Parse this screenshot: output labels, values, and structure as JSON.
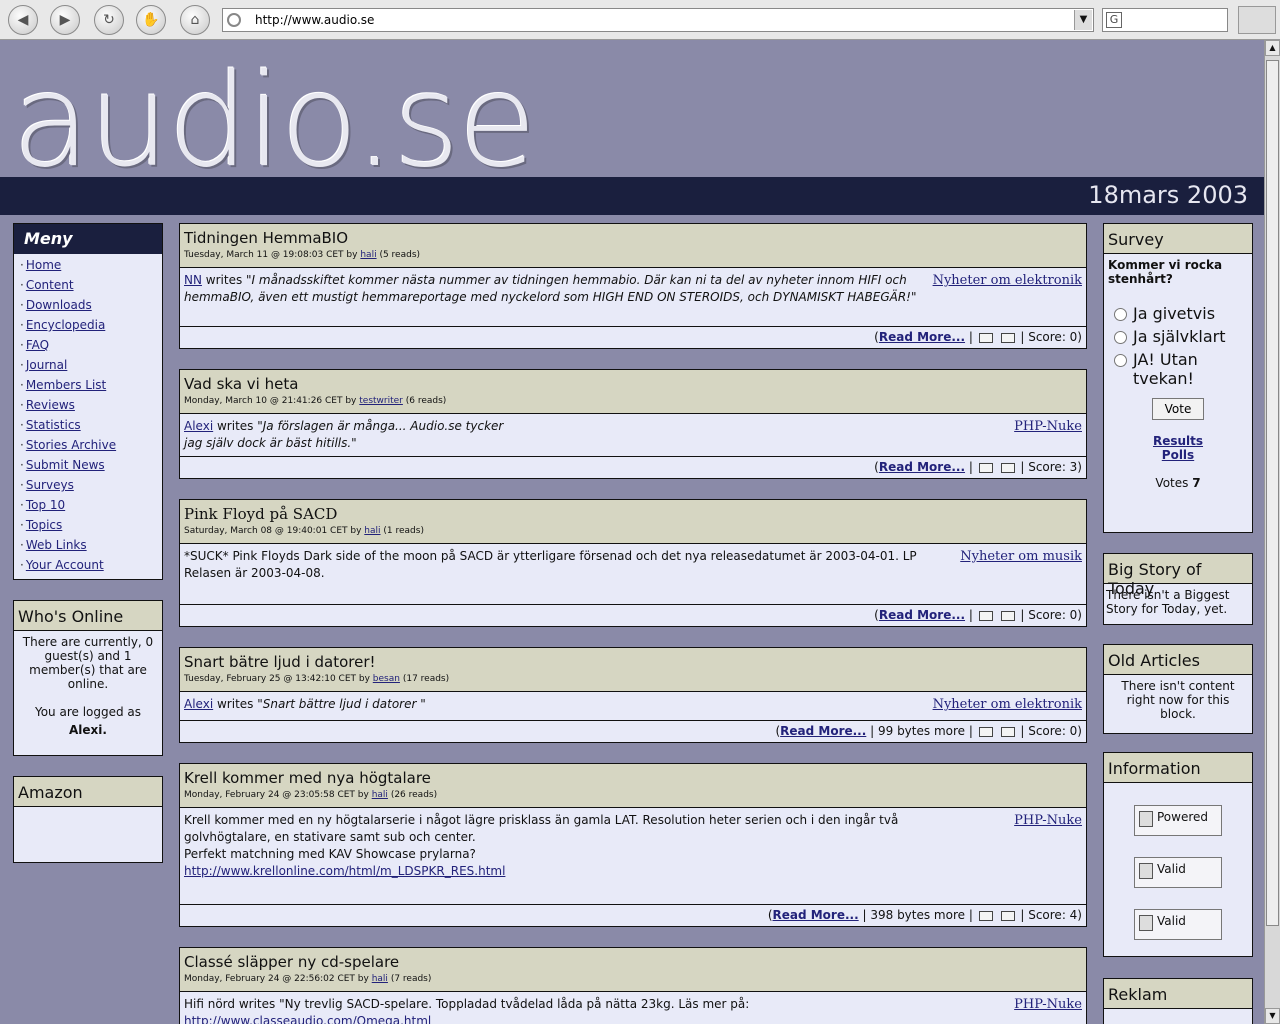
{
  "browser": {
    "url": "http://www.audio.se"
  },
  "header": {
    "logo": "audio.se",
    "date": "18mars 2003"
  },
  "menu": {
    "title": "Meny",
    "items": [
      "Home",
      "Content",
      "Downloads",
      "Encyclopedia",
      "FAQ",
      "Journal",
      "Members List",
      "Reviews",
      "Statistics",
      "Stories Archive",
      "Submit News",
      "Surveys",
      "Top 10",
      "Topics",
      "Web Links",
      "Your Account"
    ]
  },
  "whos_online": {
    "title": "Who's Online",
    "text": "There are currently, 0 guest(s) and 1 member(s) that are online.",
    "logged_as": "You are logged as",
    "user": "Alexi."
  },
  "amazon": {
    "title": "Amazon"
  },
  "articles": [
    {
      "title": "Tidningen HemmaBIO",
      "date": "Tuesday, March 11 @ 19:08:03 CET by",
      "author": "hali",
      "reads": "(5 reads)",
      "writer": "NN",
      "writes": "writes",
      "quote": "\"I månadsskiftet kommer nästa nummer av tidningen hemmabio. Där kan ni ta del av nyheter innom HIFI och hemmaBIO, även ett mustigt hemmareportage med nyckelord som HIGH END ON STEROIDS, och DYNAMISKT HABEGÄR!\"",
      "topic": "Nyheter om elektronik",
      "readmore": "Read More...",
      "bytes": "",
      "score": "Score: 0)"
    },
    {
      "title": "Vad ska vi heta",
      "date": "Monday, March 10 @ 21:41:26 CET by",
      "author": "testwriter",
      "reads": "(6 reads)",
      "writer": "Alexi",
      "writes": "writes",
      "quote": "\"Ja förslagen är många... Audio.se tycker jag själv dock är bäst hitills.\"",
      "topic": "PHP-Nuke",
      "readmore": "Read More...",
      "bytes": "",
      "score": "Score: 3)"
    },
    {
      "title": "Pink Floyd på SACD",
      "date": "Saturday, March 08 @ 19:40:01 CET by",
      "author": "hali",
      "reads": "(1 reads)",
      "body": "*SUCK* Pink Floyds Dark side of the moon på SACD är ytterligare försenad och det nya releasedatumet är 2003-04-01. LP Relasen är 2003-04-08.",
      "topic": "Nyheter om musik",
      "readmore": "Read More...",
      "bytes": "",
      "score": "Score: 0)"
    },
    {
      "title": "Snart bätre ljud i datorer!",
      "date": "Tuesday, February 25 @ 13:42:10 CET by",
      "author": "besan",
      "reads": "(17 reads)",
      "writer": "Alexi",
      "writes": "writes",
      "quote": "\"Snart bättre ljud i datorer \"",
      "topic": "Nyheter om elektronik",
      "readmore": "Read More...",
      "bytes": "99 bytes more",
      "score": "Score: 0)"
    },
    {
      "title": "Krell kommer med nya högtalare",
      "date": "Monday, February 24 @ 23:05:58 CET by",
      "author": "hali",
      "reads": "(26 reads)",
      "body": "Krell kommer med en ny högtalarserie i något lägre prisklass än gamla LAT. Resolution heter serien och i den ingår två golvhögtalare, en stativare samt sub och center.",
      "body2": "Perfekt matchning med KAV Showcase prylarna?",
      "link": "http://www.krellonline.com/html/m_LDSPKR_RES.html",
      "topic": "PHP-Nuke",
      "readmore": "Read More...",
      "bytes": "398 bytes more",
      "score": "Score: 4)"
    },
    {
      "title": "Classé släpper ny cd-spelare",
      "date": "Monday, February 24 @ 22:56:02 CET by",
      "author": "hali",
      "reads": "(7 reads)",
      "body": "Hifi nörd writes \"Ny trevlig SACD-spelare. Toppladad tvådelad låda på nätta 23kg. Läs mer på:",
      "link": "http://www.classeaudio.com/Omega.html",
      "topic": "PHP-Nuke"
    }
  ],
  "survey": {
    "title": "Survey",
    "question": "Kommer vi rocka stenhårt?",
    "options": [
      "Ja givetvis",
      "Ja självklart",
      "JA! Utan tvekan!"
    ],
    "vote": "Vote",
    "results": "Results",
    "polls": "Polls",
    "votes_label": "Votes",
    "votes_count": "7"
  },
  "big_story": {
    "title": "Big Story of Today",
    "text": "There isn't a Biggest Story for Today, yet."
  },
  "old_articles": {
    "title": "Old Articles",
    "text": "There isn't content right now for this block."
  },
  "information": {
    "title": "Information",
    "badges": [
      "Powered",
      "Valid",
      "Valid"
    ]
  },
  "reklam": {
    "title": "Reklam"
  }
}
